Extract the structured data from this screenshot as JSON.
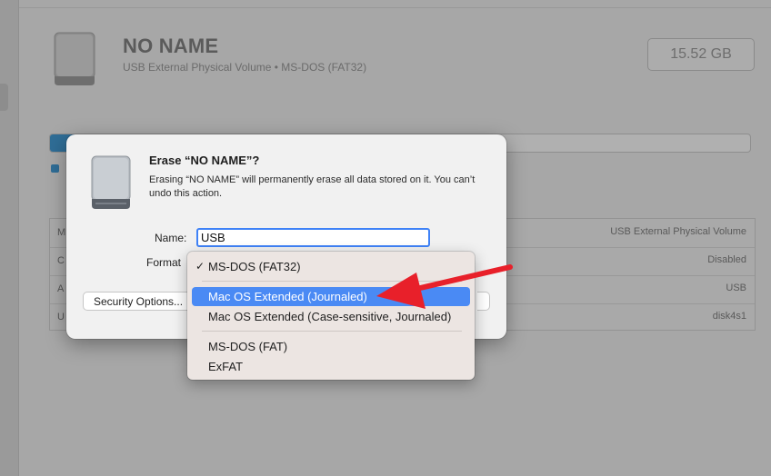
{
  "volume": {
    "name": "NO NAME",
    "subtitle": "USB External Physical Volume • MS-DOS (FAT32)",
    "capacity": "15.52 GB",
    "usage_fraction": 0.57
  },
  "info_table": {
    "rows": [
      {
        "label": "M",
        "value": "USB External Physical Volume"
      },
      {
        "label": "C",
        "value": "Disabled"
      },
      {
        "label": "A",
        "value": "USB"
      },
      {
        "label": "U",
        "value": "disk4s1"
      }
    ]
  },
  "dialog": {
    "title": "Erase “NO NAME”?",
    "message": "Erasing “NO NAME” will permanently erase all data stored on it. You can’t undo this action.",
    "name_label": "Name:",
    "name_value": "USB",
    "format_label": "Format",
    "security_button": "Security Options..."
  },
  "format_menu": {
    "items": [
      {
        "label": "MS-DOS (FAT32)",
        "checked": true,
        "selected": false
      },
      {
        "label": "Mac OS Extended (Journaled)",
        "checked": false,
        "selected": true
      },
      {
        "label": "Mac OS Extended (Case-sensitive, Journaled)",
        "checked": false,
        "selected": false
      },
      {
        "label": "MS-DOS (FAT)",
        "checked": false,
        "selected": false
      },
      {
        "label": "ExFAT",
        "checked": false,
        "selected": false
      }
    ],
    "check_glyph": "✓"
  },
  "colors": {
    "accent": "#4a8af4",
    "annotation_arrow": "#e8202a"
  }
}
